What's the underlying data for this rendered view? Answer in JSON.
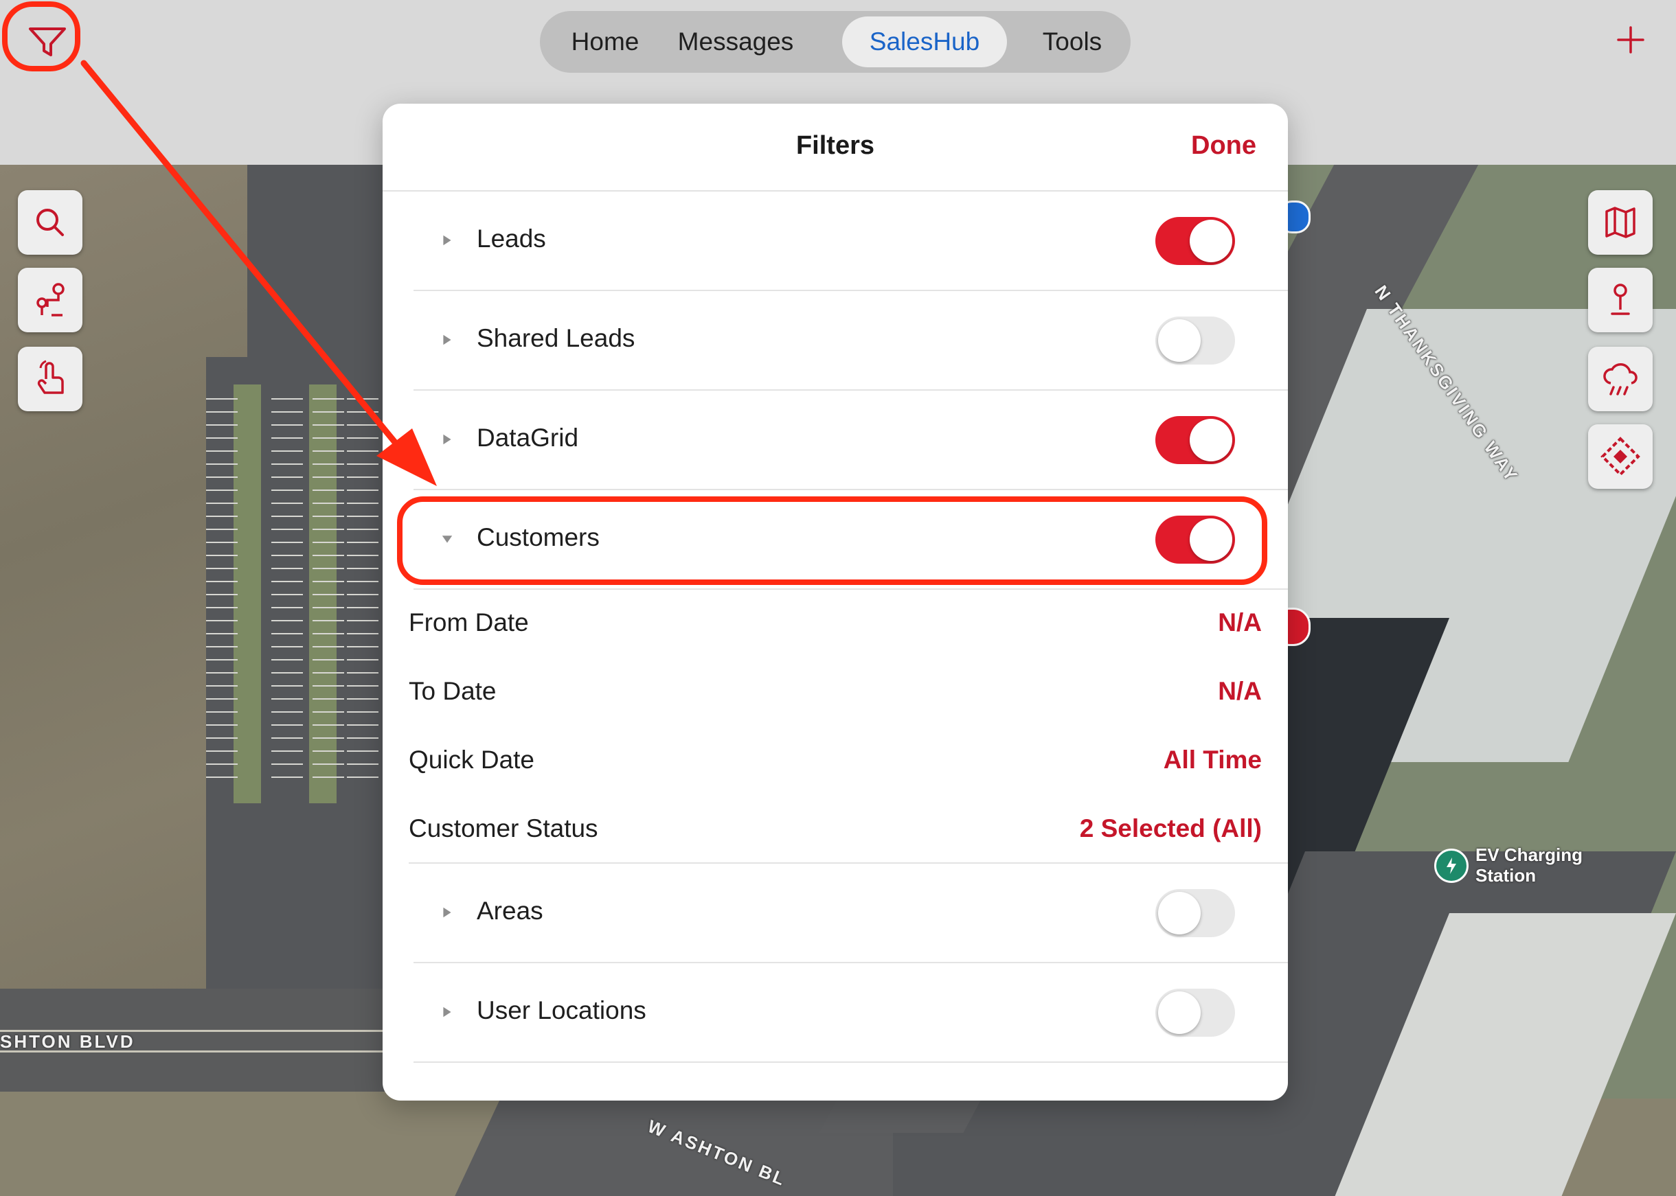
{
  "nav": {
    "tabs": [
      {
        "label": "Home"
      },
      {
        "label": "Messages"
      },
      {
        "label": "SalesHub"
      },
      {
        "label": "Tools"
      }
    ],
    "active_tab": "SalesHub"
  },
  "filters": {
    "title": "Filters",
    "done_label": "Done",
    "layers": [
      {
        "label": "Leads",
        "enabled": true,
        "expanded": false
      },
      {
        "label": "Shared Leads",
        "enabled": false,
        "expanded": false
      },
      {
        "label": "DataGrid",
        "enabled": true,
        "expanded": false
      },
      {
        "label": "Customers",
        "enabled": true,
        "expanded": true
      },
      {
        "label": "Areas",
        "enabled": false,
        "expanded": false
      },
      {
        "label": "User Locations",
        "enabled": false,
        "expanded": false
      }
    ],
    "customer_options": [
      {
        "label": "From Date",
        "value": "N/A"
      },
      {
        "label": "To Date",
        "value": "N/A"
      },
      {
        "label": "Quick Date",
        "value": "All Time"
      },
      {
        "label": "Customer Status",
        "value": "2 Selected (All)"
      }
    ]
  },
  "map": {
    "labels": {
      "thanksgiving": "N THANKSGIVING WAY",
      "ashton_blvd": "SHTON BLVD",
      "w_ashton": "W ASHTON BL",
      "ev_station_line1": "EV Charging",
      "ev_station_line2": "Station"
    }
  },
  "colors": {
    "accent": "#c5162a",
    "toggle_on": "#e11b2b",
    "active_tab": "#1a64c8",
    "annotation": "#ff2a12"
  },
  "icons": {
    "left_tools": [
      "search-icon",
      "route-icon",
      "tap-icon"
    ],
    "right_tools": [
      "map-icon",
      "pin-icon",
      "weather-icon",
      "diamond-marker-icon"
    ],
    "top_left": "filter-icon",
    "top_right": "plus-icon"
  }
}
